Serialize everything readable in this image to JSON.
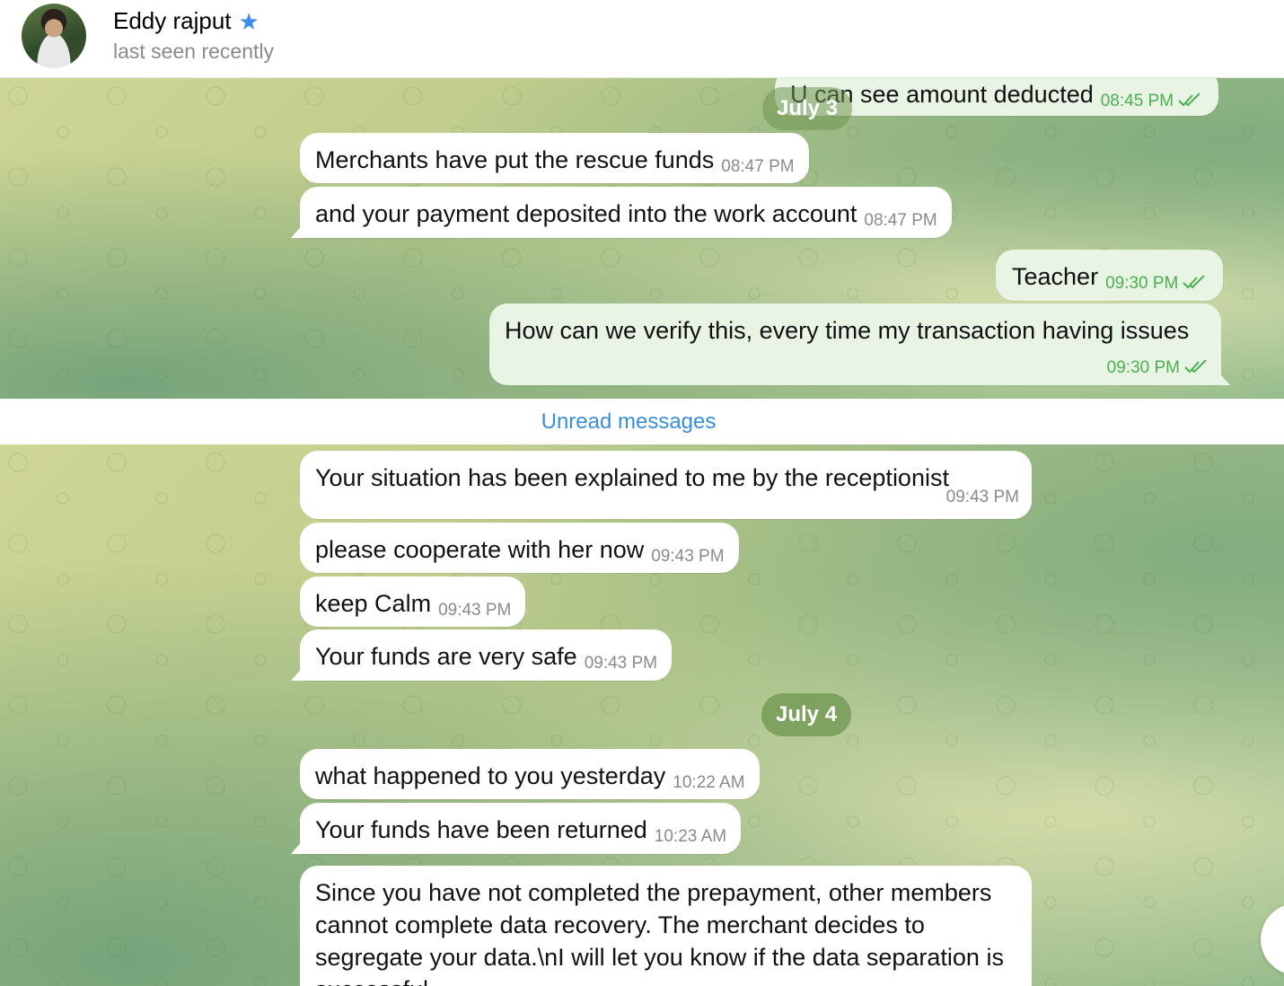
{
  "header": {
    "name": "Eddy rajput",
    "status": "last seen recently",
    "star_icon": "star-icon"
  },
  "top_messages": [
    {
      "text": "U can see amount deducted",
      "time": "08:45 PM",
      "dir": "out"
    },
    {
      "text": "Merchants have put the rescue funds",
      "time": "08:47 PM",
      "dir": "in"
    },
    {
      "text": "and your payment deposited into the work account",
      "time": "08:47 PM",
      "dir": "in"
    },
    {
      "text": "Teacher",
      "time": "09:30 PM",
      "dir": "out"
    },
    {
      "text": "How can we verify this, every time my transaction having issues",
      "time": "09:30 PM",
      "dir": "out"
    }
  ],
  "date_july3": "July 3",
  "unread_label": "Unread messages",
  "bottom_messages": [
    {
      "text": "Your situation has been explained to me by the receptionist",
      "time": "09:43 PM"
    },
    {
      "text": "please cooperate with her now",
      "time": "09:43 PM"
    },
    {
      "text": "keep Calm",
      "time": "09:43 PM"
    },
    {
      "text": "Your funds are very safe",
      "time": "09:43 PM"
    }
  ],
  "date_july4": "July 4",
  "july4_messages": [
    {
      "text": "what happened to you yesterday",
      "time": "10:22 AM"
    },
    {
      "text": "Your funds have been returned",
      "time": "10:23 AM"
    },
    {
      "text": "Since you have not completed the prepayment, other members cannot complete data recovery. The merchant decides to segregate your data.\\nI will let you know if the data separation is successful"
    }
  ],
  "colors": {
    "accent": "#3a8fd8",
    "outgoing_bubble": "#e8f4e4",
    "incoming_bubble": "#ffffff",
    "read_ticks": "#4caf50"
  }
}
